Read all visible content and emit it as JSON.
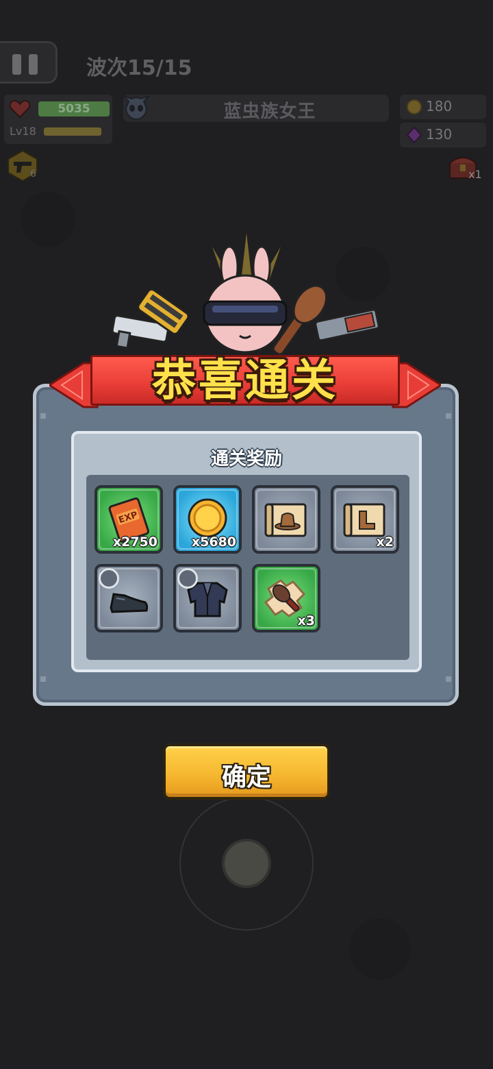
{
  "hud": {
    "wave_label": "波次15/15",
    "hp_value": "5035",
    "hp_fraction": 1.0,
    "level_label": "Lv18",
    "exp_fraction": 1.0,
    "boss_name": "蓝虫族女王",
    "gold": "180",
    "gems": "130",
    "weapon_count": "6",
    "chest_count": "x1"
  },
  "dialog": {
    "banner_title": "恭喜通关",
    "rewards_title": "通关奖励",
    "rewards": [
      {
        "name": "exp-book",
        "qty": "x2750",
        "rarity": "green"
      },
      {
        "name": "gold-coin",
        "qty": "x5680",
        "rarity": "blue"
      },
      {
        "name": "hat-scroll",
        "qty": "",
        "rarity": "gray"
      },
      {
        "name": "boots-scroll",
        "qty": "x2",
        "rarity": "gray"
      },
      {
        "name": "leather-shoes",
        "qty": "",
        "rarity": "gray"
      },
      {
        "name": "suit-jacket",
        "qty": "",
        "rarity": "gray"
      },
      {
        "name": "club-puzzle-piece",
        "qty": "x3",
        "rarity": "green"
      }
    ],
    "confirm_label": "确定"
  },
  "colors": {
    "ribbon": "#e83d36",
    "title_yellow": "#ffe14a",
    "confirm": "#f5b52e",
    "panel": "#68788b"
  }
}
